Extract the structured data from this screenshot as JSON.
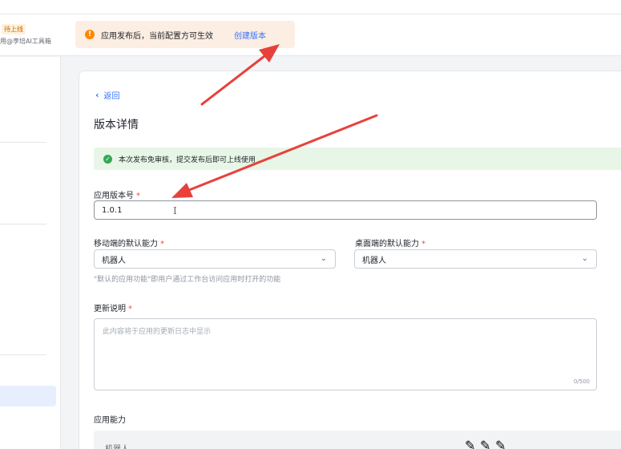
{
  "header": {
    "status_badge": "待上线",
    "app_owner": "用@李培AI工具箱",
    "notice": {
      "text": "应用发布后，当前配置方可生效",
      "link": "创建版本",
      "icon": "warning-icon"
    }
  },
  "version_detail": {
    "back_label": "返回",
    "title": "版本详情",
    "success_notice": "本次发布免审核，提交发布后即可上线使用",
    "version_label": "应用版本号",
    "version_value": "1.0.1",
    "mobile_label": "移动端的默认能力",
    "mobile_value": "机器人",
    "desktop_label": "桌面端的默认能力",
    "desktop_value": "机器人",
    "hint": "\"默认的应用功能\"即用户通过工作台访问应用时打开的功能",
    "changelog_label": "更新说明",
    "changelog_placeholder": "此内容将于应用的更新日志中显示",
    "changelog_count": "0/500",
    "capabilities_label": "应用能力",
    "capability_item": "机器人"
  },
  "colors": {
    "accent": "#3370ff",
    "required": "#f54a45",
    "annotation_arrow": "#e8413c",
    "success_bg": "#e8f6e7",
    "notice_bg": "#fdeee3"
  }
}
